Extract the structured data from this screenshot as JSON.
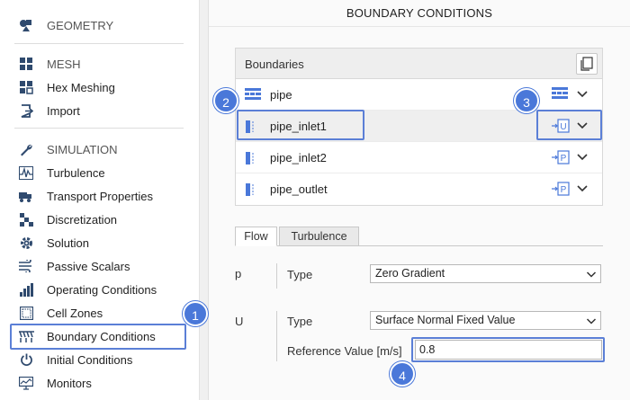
{
  "sidebar": {
    "geometry": "GEOMETRY",
    "mesh": "MESH",
    "hex_meshing": "Hex Meshing",
    "import": "Import",
    "simulation": "SIMULATION",
    "items": [
      "Turbulence",
      "Transport Properties",
      "Discretization",
      "Solution",
      "Passive Scalars",
      "Operating Conditions",
      "Cell Zones",
      "Boundary Conditions",
      "Initial Conditions",
      "Monitors"
    ],
    "selected": "Boundary Conditions"
  },
  "panel": {
    "title": "BOUNDARY CONDITIONS",
    "boundaries_header": "Boundaries",
    "boundaries": [
      {
        "name": "pipe",
        "type_icon": "wall-icon",
        "type_letter": ""
      },
      {
        "name": "pipe_inlet1",
        "type_icon": "velocity-inlet-icon",
        "type_letter": "U"
      },
      {
        "name": "pipe_inlet2",
        "type_icon": "pressure-icon",
        "type_letter": "P"
      },
      {
        "name": "pipe_outlet",
        "type_icon": "pressure-icon",
        "type_letter": "P"
      }
    ],
    "selected_boundary": "pipe_inlet1",
    "tabs": [
      "Flow",
      "Turbulence"
    ],
    "active_tab": "Flow",
    "p": {
      "var": "p",
      "type_label": "Type",
      "type_value": "Zero Gradient"
    },
    "u": {
      "var": "U",
      "type_label": "Type",
      "type_value": "Surface Normal Fixed Value",
      "ref_label": "Reference Value [m/s]",
      "ref_value": "0.8"
    }
  },
  "callouts": [
    "1",
    "2",
    "3",
    "4"
  ],
  "colors": {
    "accent": "#4a78d9",
    "icon": "#2f4a6e",
    "boundary_icon": "#4a78d9"
  }
}
